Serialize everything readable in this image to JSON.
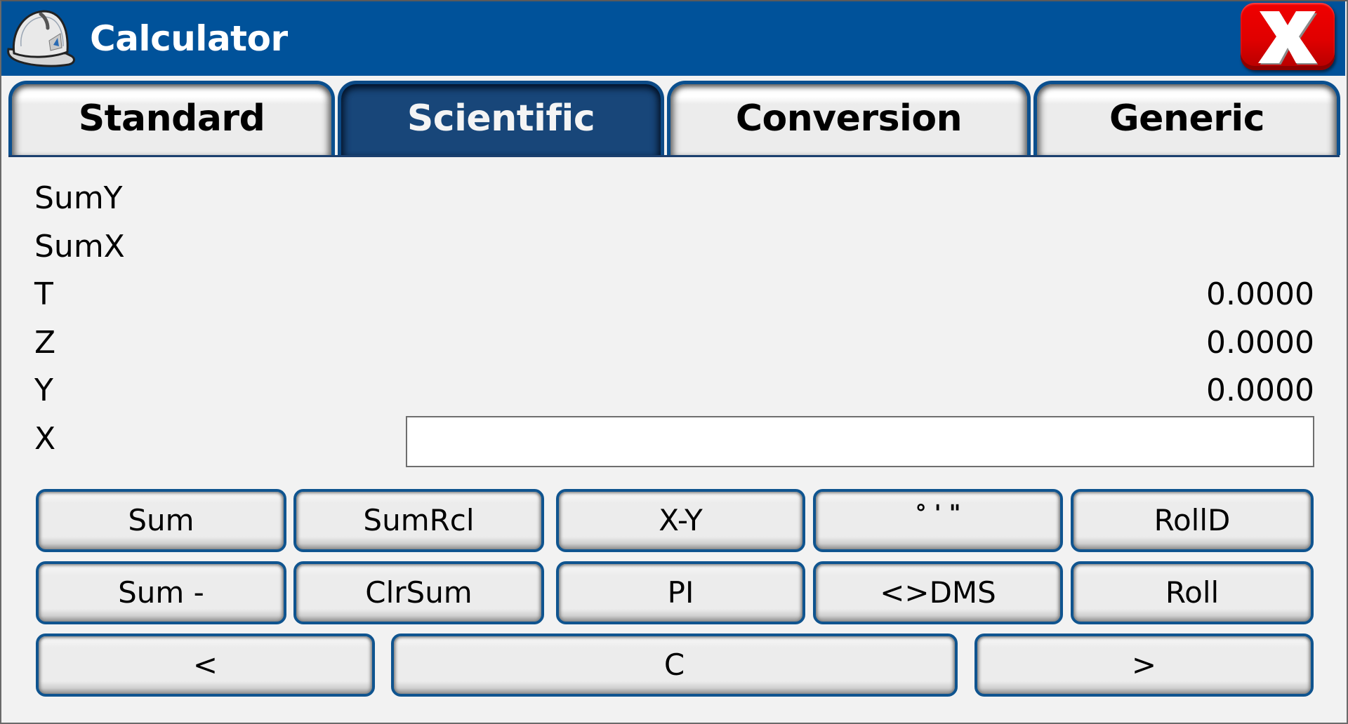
{
  "window": {
    "title": "Calculator",
    "app_icon": "hard-hat-icon",
    "close_icon": "close-x-icon"
  },
  "tabs": [
    {
      "label": "Standard",
      "active": false
    },
    {
      "label": "Scientific",
      "active": true
    },
    {
      "label": "Conversion",
      "active": false
    },
    {
      "label": "Generic",
      "active": false
    }
  ],
  "registers": [
    {
      "label": "SumY",
      "value": ""
    },
    {
      "label": "SumX",
      "value": ""
    },
    {
      "label": "T",
      "value": "0.0000"
    },
    {
      "label": "Z",
      "value": "0.0000"
    },
    {
      "label": "Y",
      "value": "0.0000"
    },
    {
      "label": "X",
      "value": ""
    }
  ],
  "x_input": {
    "value": "",
    "placeholder": ""
  },
  "buttons": {
    "row1": [
      "Sum",
      "SumRcl",
      "X-Y",
      "° ' \"",
      "RollD"
    ],
    "row2": [
      "Sum -",
      "ClrSum",
      "PI",
      "<>DMS",
      "Roll"
    ],
    "row3": [
      "<",
      "C",
      ">"
    ]
  },
  "colors": {
    "titlebar": "#00529a",
    "active_tab": "#184679",
    "button_border": "#0f548f",
    "close_button": "#e00000",
    "background": "#f2f2f2"
  }
}
